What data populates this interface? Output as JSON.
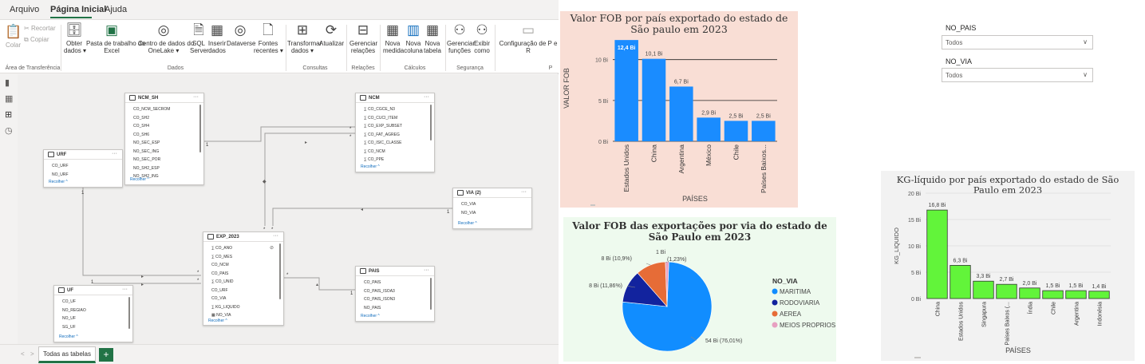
{
  "menu": {
    "tabs": [
      "Arquivo",
      "Página Inicial",
      "Ajuda"
    ]
  },
  "ribbon": {
    "buttons": [
      {
        "id": "recortar",
        "label": "Recortar",
        "icon": "scissors-icon"
      },
      {
        "id": "copiar",
        "label": "Copiar",
        "icon": "copy-icon"
      },
      {
        "id": "colar",
        "label": "Colar",
        "icon": "paste-icon"
      },
      {
        "id": "obter",
        "label": "Obter\ndados ▾",
        "icon": "database-icon"
      },
      {
        "id": "excel",
        "label": "Pasta de trabalho do\nExcel",
        "icon": "excel-icon"
      },
      {
        "id": "onelake",
        "label": "Centro de dados do\nOneLake ▾",
        "icon": "onelake-icon"
      },
      {
        "id": "sql",
        "label": "SQL\nServer",
        "icon": "sql-icon"
      },
      {
        "id": "inserir",
        "label": "Inserir\ndados",
        "icon": "table-icon"
      },
      {
        "id": "dataverse",
        "label": "Dataverse",
        "icon": "dataverse-icon"
      },
      {
        "id": "fontes",
        "label": "Fontes\nrecentes ▾",
        "icon": "recent-sources-icon"
      },
      {
        "id": "transformar",
        "label": "Transformar\ndados ▾",
        "icon": "transform-icon"
      },
      {
        "id": "atualizar",
        "label": "Atualizar",
        "icon": "refresh-icon"
      },
      {
        "id": "gerenciar_rel",
        "label": "Gerenciar\nrelações",
        "icon": "relationships-icon"
      },
      {
        "id": "nova_medida",
        "label": "Nova\nmedida",
        "icon": "calculator-icon"
      },
      {
        "id": "nova_coluna",
        "label": "Nova\ncoluna",
        "icon": "column-icon"
      },
      {
        "id": "nova_tabela",
        "label": "Nova\ntabela",
        "icon": "new-table-icon"
      },
      {
        "id": "gerenciar_func",
        "label": "Gerenciar\nfunções",
        "icon": "roles-icon"
      },
      {
        "id": "exibir_como",
        "label": "Exibir\ncomo",
        "icon": "view-as-icon"
      },
      {
        "id": "config",
        "label": "Configuração de P e\nR",
        "icon": "qa-setup-icon"
      }
    ],
    "groups": [
      "Área de Transferência",
      "Dados",
      "Consultas",
      "Relações",
      "Cálculos",
      "Segurança",
      "P"
    ]
  },
  "tables": [
    {
      "id": "ncm_sh",
      "name": "NCM_SH",
      "fields": [
        "CO_NCM_SECROM",
        "CO_SH2",
        "CO_SH4",
        "CO_SH6",
        "NO_SEC_ESP",
        "NO_SEC_ING",
        "NO_SEC_POR",
        "NO_SH2_ESP",
        "NO_SH2_ING"
      ],
      "collapse": "Recolher ^"
    },
    {
      "id": "ncm",
      "name": "NCM",
      "fields": [
        "∑ CO_CGCE_N3",
        "∑ CO_CUCI_ITEM",
        "∑ CO_EXP_SUBSET",
        "∑ CO_FAT_AGREG",
        "∑ CO_ISIC_CLASSE",
        "∑ CO_NCM",
        "∑ CO_PPE"
      ],
      "collapse": "Recolher ^"
    },
    {
      "id": "urf",
      "name": "URF",
      "fields": [
        "CO_URF",
        "NO_URF"
      ],
      "collapse": "Recolher ^"
    },
    {
      "id": "via2",
      "name": "VIA (2)",
      "fields": [
        "CO_VIA",
        "NO_VIA"
      ],
      "collapse": "Recolher ^"
    },
    {
      "id": "exp2023",
      "name": "EXP_2023",
      "fields": [
        "∑ CO_ANO",
        "∑ CO_MES",
        "CO_NCM",
        "CO_PAIS",
        "∑ CO_UNID",
        "CO_URF",
        "CO_VIA",
        "∑ KG_LIQUIDO",
        "▦ NO_VIA"
      ],
      "collapse": "Recolher ^"
    },
    {
      "id": "pais",
      "name": "PAIS",
      "fields": [
        "CO_PAIS",
        "CO_PAIS_ISOA3",
        "CO_PAIS_ISON3",
        "NO_PAIS",
        "NO_PAIS_ING"
      ],
      "collapse": "Recolher ^"
    },
    {
      "id": "uf",
      "name": "UF",
      "fields": [
        "CO_UF",
        "NO_REGIAO",
        "NO_UF",
        "SG_UF"
      ],
      "collapse": "Recolher ^"
    }
  ],
  "relationships": {
    "one": "1",
    "many": "*"
  },
  "bottom": {
    "tab_label": "Todas as tabelas",
    "add_label": "+",
    "prev": "<",
    "next": ">"
  },
  "slicers": [
    {
      "label": "NO_PAIS",
      "value": "Todos"
    },
    {
      "label": "NO_VIA",
      "value": "Todos"
    }
  ],
  "chart_data": [
    {
      "type": "bar",
      "title": "Valor FOB por país exportado do estado de São paulo em 2023",
      "xlabel": "PAÍSES",
      "ylabel": "VALOR FOB",
      "categories": [
        "Estados Unidos",
        "China",
        "Argentina",
        "México",
        "Chile",
        "Países Baixos..."
      ],
      "values": [
        12.4,
        10.1,
        6.7,
        2.9,
        2.5,
        2.5
      ],
      "data_labels": [
        "12,4 Bi",
        "10,1 Bi",
        "6,7 Bi",
        "2,9 Bi",
        "2,5 Bi",
        "2,5 Bi"
      ],
      "yticks": [
        "0 Bi",
        "5 Bi",
        "10 Bi"
      ],
      "ylim": [
        0,
        13
      ],
      "grid": true,
      "color": "#1a8cff",
      "background": "#f9ded5"
    },
    {
      "type": "pie",
      "title": "Valor FOB das exportações por via do estado de São Paulo em 2023",
      "legend_title": "NO_VIA",
      "slices": [
        {
          "name": "MARITIMA",
          "value": 76.01,
          "label": "54 Bi (76,01%)",
          "color": "#118dff"
        },
        {
          "name": "RODOVIARIA",
          "value": 11.86,
          "label": "8 Bi (11,86%)",
          "color": "#12239e"
        },
        {
          "name": "AEREA",
          "value": 10.9,
          "label": "8 Bi (10,9%)",
          "color": "#e66c37"
        },
        {
          "name": "MEIOS PROPRIOS",
          "value": 1.23,
          "label": "1 Bi",
          "label2": "(1,23%)",
          "color": "#e7a0c1"
        }
      ],
      "background": "#eefaee"
    },
    {
      "type": "bar",
      "title": "KG-líquido por país exportado do estado de São Paulo em 2023",
      "xlabel": "PAÍSES",
      "ylabel": "KG_LIQUIDO",
      "categories": [
        "China",
        "Estados Unidos",
        "Singapura",
        "Países Baixos (...",
        "Índia",
        "Chile",
        "Argentina",
        "Indonésia"
      ],
      "values": [
        16.8,
        6.3,
        3.3,
        2.7,
        2.0,
        1.5,
        1.5,
        1.4
      ],
      "data_labels": [
        "16,8 Bi",
        "6,3 Bi",
        "3,3 Bi",
        "2,7 Bi",
        "2,0 Bi",
        "1,5 Bi",
        "1,5 Bi",
        "1,4 Bi"
      ],
      "yticks": [
        "0 Bi",
        "5 Bi",
        "10 Bi",
        "15 Bi",
        "20 Bi"
      ],
      "ylim": [
        0,
        20
      ],
      "grid": true,
      "color": "#62f43a",
      "background": "#f2f2f2"
    }
  ]
}
